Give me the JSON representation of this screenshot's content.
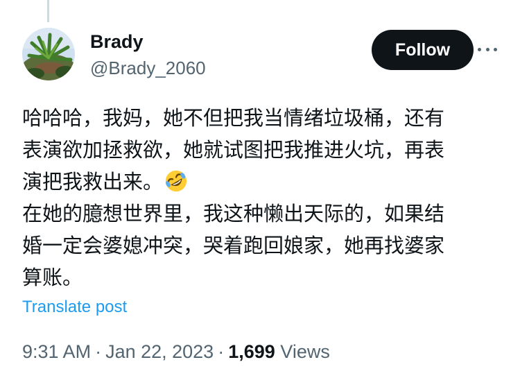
{
  "author": {
    "name": "Brady",
    "handle": "@Brady_2060",
    "avatar_icon": "avatar-plant-photo"
  },
  "header": {
    "follow_label": "Follow",
    "more_icon": "more-horizontal-icon"
  },
  "post": {
    "lines": [
      "哈哈哈，我妈，她不但把我当情绪垃圾桶，还有",
      "表演欲加拯救欲，她就试图把我推进火坑，再表",
      "演把我救出来。",
      "在她的臆想世界里，我这种懒出天际的，如果结",
      "婚一定会婆媳冲突，哭着跑回娘家，她再找婆家",
      "算账。"
    ],
    "emoji_icon": "rolling-on-floor-laughing-emoji-icon"
  },
  "translate_label": "Translate post",
  "meta": {
    "time": "9:31 AM",
    "date": "Jan 22, 2023",
    "separator": "·",
    "views_count": "1,699",
    "views_label": "Views"
  },
  "colors": {
    "text": "#0f1419",
    "secondary": "#536471",
    "link": "#1d9bf0",
    "button_bg": "#0f1419",
    "button_text": "#ffffff"
  }
}
